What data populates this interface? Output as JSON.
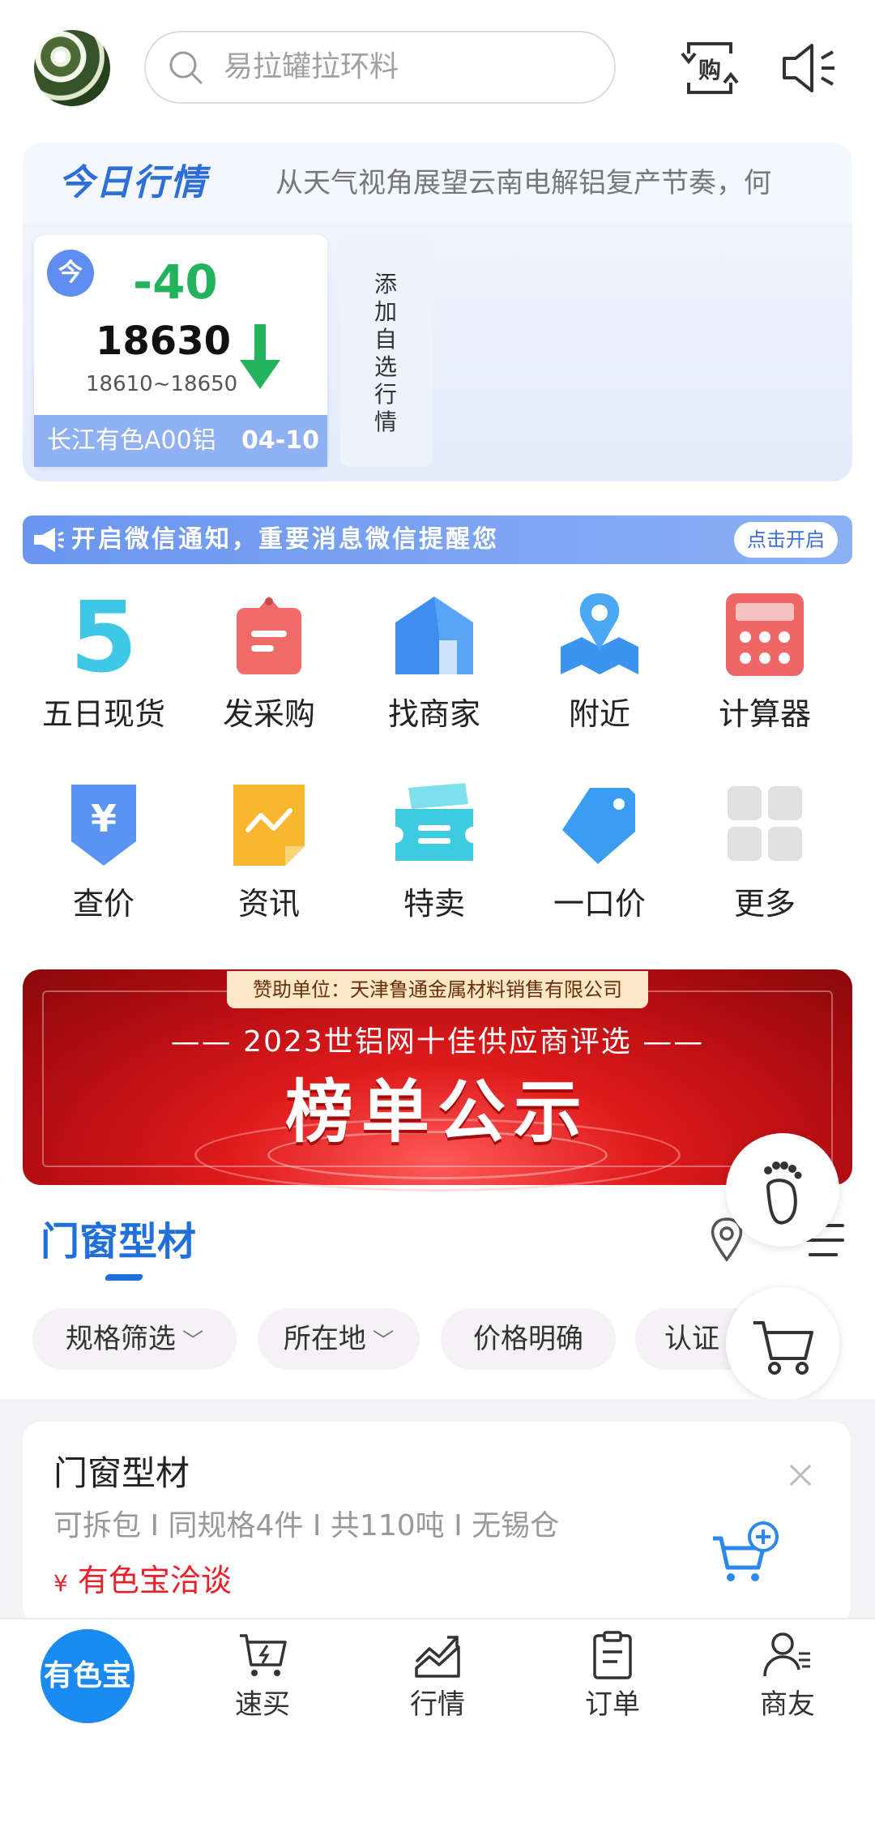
{
  "header": {
    "search_placeholder": "易拉罐拉环料"
  },
  "market": {
    "title": "今日行情",
    "news": "从天气视角展望云南电解铝复产节奏，何",
    "today_badge": "今",
    "change": "-40",
    "price": "18630",
    "range": "18610~18650",
    "name": "长江有色A00铝",
    "date": "04-10",
    "add_watch": "添加自选行情"
  },
  "notify": {
    "text": "开启微信通知，重要消息微信提醒您",
    "button": "点击开启"
  },
  "grid": [
    {
      "label": "五日现货",
      "icon": "five-icon"
    },
    {
      "label": "发采购",
      "icon": "purchase-tag-icon"
    },
    {
      "label": "找商家",
      "icon": "shop-house-icon"
    },
    {
      "label": "附近",
      "icon": "nearby-map-icon"
    },
    {
      "label": "计算器",
      "icon": "calculator-icon"
    },
    {
      "label": "查价",
      "icon": "yuan-shield-icon"
    },
    {
      "label": "资讯",
      "icon": "news-chart-icon"
    },
    {
      "label": "特卖",
      "icon": "ticket-icon"
    },
    {
      "label": "一口价",
      "icon": "price-tag-icon"
    },
    {
      "label": "更多",
      "icon": "more-grid-icon"
    }
  ],
  "banner": {
    "sponsor": "赞助单位：天津鲁通金属材料销售有限公司",
    "subtitle": "—— 2023世铝网十佳供应商评选 ——",
    "title": "榜单公示"
  },
  "section": {
    "title": "门窗型材",
    "chips": [
      "规格筛选",
      "所在地",
      "价格明确",
      "认证"
    ]
  },
  "listing": {
    "title": "门窗型材",
    "specs": "可拆包 I 同规格4件 I 共110吨 I 无锡仓",
    "price_symbol": "¥",
    "price": "有色宝洽谈"
  },
  "nav": {
    "home": "有色宝",
    "items": [
      {
        "label": "速买",
        "icon": "quick-buy-cart-icon"
      },
      {
        "label": "行情",
        "icon": "market-trend-icon"
      },
      {
        "label": "订单",
        "icon": "order-clipboard-icon"
      },
      {
        "label": "商友",
        "icon": "contacts-user-icon"
      }
    ]
  },
  "colors": {
    "accent": "#1f6fdc",
    "down": "#22b35c",
    "price_red": "#e8202a"
  }
}
